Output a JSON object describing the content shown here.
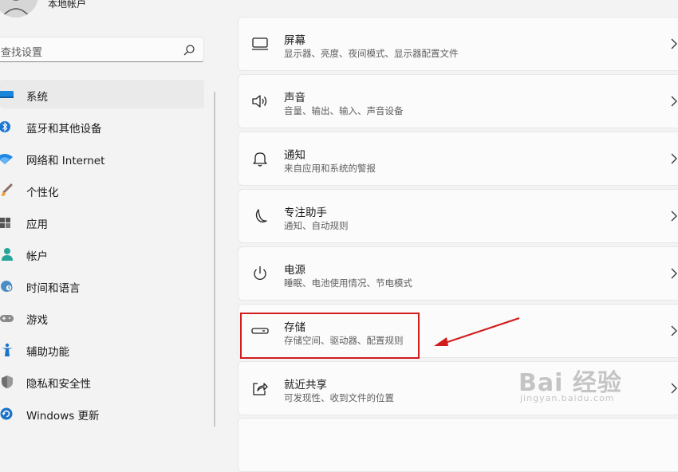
{
  "account": {
    "name": "本地帐户"
  },
  "search": {
    "placeholder": "查找设置"
  },
  "nav": {
    "items": [
      {
        "label": "系统",
        "icon": "monitor-icon",
        "active": true
      },
      {
        "label": "蓝牙和其他设备",
        "icon": "bluetooth-icon"
      },
      {
        "label": "网络和 Internet",
        "icon": "wifi-icon"
      },
      {
        "label": "个性化",
        "icon": "brush-icon"
      },
      {
        "label": "应用",
        "icon": "apps-icon"
      },
      {
        "label": "帐户",
        "icon": "person-icon"
      },
      {
        "label": "时间和语言",
        "icon": "clock-globe-icon"
      },
      {
        "label": "游戏",
        "icon": "gamepad-icon"
      },
      {
        "label": "辅助功能",
        "icon": "accessibility-icon"
      },
      {
        "label": "隐私和安全性",
        "icon": "shield-icon"
      },
      {
        "label": "Windows 更新",
        "icon": "update-icon"
      }
    ]
  },
  "settings": {
    "cards": [
      {
        "title": "屏幕",
        "subtitle": "显示器、亮度、夜间模式、显示器配置文件",
        "icon": "display-icon"
      },
      {
        "title": "声音",
        "subtitle": "音量、输出、输入、声音设备",
        "icon": "speaker-icon"
      },
      {
        "title": "通知",
        "subtitle": "来自应用和系统的警报",
        "icon": "bell-icon"
      },
      {
        "title": "专注助手",
        "subtitle": "通知、自动规则",
        "icon": "moon-icon"
      },
      {
        "title": "电源",
        "subtitle": "睡眠、电池使用情况、节电模式",
        "icon": "power-icon"
      },
      {
        "title": "存储",
        "subtitle": "存储空间、驱动器、配置规则",
        "icon": "storage-icon"
      },
      {
        "title": "就近共享",
        "subtitle": "可发现性、收到文件的位置",
        "icon": "share-icon"
      }
    ]
  },
  "watermark": {
    "main": "Bai 经验",
    "sub": "jingyan.baidu.com"
  },
  "colors": {
    "accent": "#0067c0",
    "annotation": "#d21d1d"
  }
}
